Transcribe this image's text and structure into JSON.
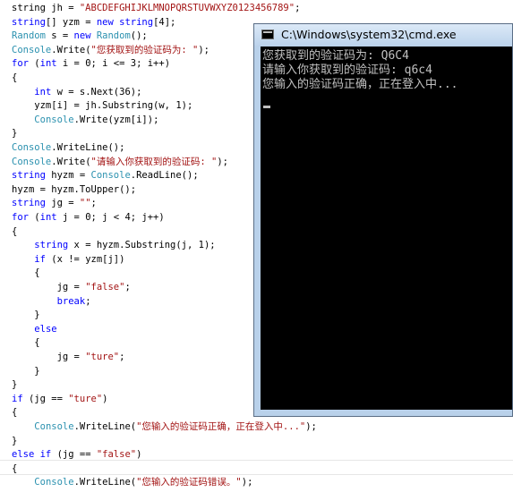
{
  "editor": {
    "lines": [
      [
        {
          "t": "pl",
          "v": "string jh = "
        },
        {
          "t": "str",
          "v": "\"ABCDEFGHIJKLMNOPQRSTUVWXYZ0123456789\""
        },
        {
          "t": "pl",
          "v": ";"
        }
      ],
      [
        {
          "t": "kw",
          "v": "string"
        },
        {
          "t": "pl",
          "v": "[] yzm = "
        },
        {
          "t": "kw",
          "v": "new string"
        },
        {
          "t": "pl",
          "v": "[4];"
        }
      ],
      [
        {
          "t": "cls",
          "v": "Random"
        },
        {
          "t": "pl",
          "v": " s = "
        },
        {
          "t": "kw",
          "v": "new "
        },
        {
          "t": "cls",
          "v": "Random"
        },
        {
          "t": "pl",
          "v": "();"
        }
      ],
      [
        {
          "t": "cls",
          "v": "Console"
        },
        {
          "t": "pl",
          "v": ".Write("
        },
        {
          "t": "str",
          "v": "\"您获取到的验证码为: \""
        },
        {
          "t": "pl",
          "v": ");"
        }
      ],
      [
        {
          "t": "kw",
          "v": "for"
        },
        {
          "t": "pl",
          "v": " ("
        },
        {
          "t": "kw",
          "v": "int"
        },
        {
          "t": "pl",
          "v": " i = 0; i <= 3; i++)"
        }
      ],
      [
        {
          "t": "pl",
          "v": "{"
        }
      ],
      [
        {
          "t": "pl",
          "v": "    "
        },
        {
          "t": "kw",
          "v": "int"
        },
        {
          "t": "pl",
          "v": " w = s.Next(36);"
        }
      ],
      [
        {
          "t": "pl",
          "v": "    yzm[i] = jh.Substring(w, 1);"
        }
      ],
      [
        {
          "t": "pl",
          "v": "    "
        },
        {
          "t": "cls",
          "v": "Console"
        },
        {
          "t": "pl",
          "v": ".Write(yzm[i]);"
        }
      ],
      [
        {
          "t": "pl",
          "v": "}"
        }
      ],
      [
        {
          "t": "cls",
          "v": "Console"
        },
        {
          "t": "pl",
          "v": ".WriteLine();"
        }
      ],
      [
        {
          "t": "cls",
          "v": "Console"
        },
        {
          "t": "pl",
          "v": ".Write("
        },
        {
          "t": "str",
          "v": "\"请输入你获取到的验证码: \""
        },
        {
          "t": "pl",
          "v": ");"
        }
      ],
      [
        {
          "t": "kw",
          "v": "string"
        },
        {
          "t": "pl",
          "v": " hyzm = "
        },
        {
          "t": "cls",
          "v": "Console"
        },
        {
          "t": "pl",
          "v": ".ReadLine();"
        }
      ],
      [
        {
          "t": "pl",
          "v": "hyzm = hyzm.ToUpper();"
        }
      ],
      [
        {
          "t": "kw",
          "v": "string"
        },
        {
          "t": "pl",
          "v": " jg = "
        },
        {
          "t": "str",
          "v": "\"\""
        },
        {
          "t": "pl",
          "v": ";"
        }
      ],
      [
        {
          "t": "kw",
          "v": "for"
        },
        {
          "t": "pl",
          "v": " ("
        },
        {
          "t": "kw",
          "v": "int"
        },
        {
          "t": "pl",
          "v": " j = 0; j < 4; j++)"
        }
      ],
      [
        {
          "t": "pl",
          "v": "{"
        }
      ],
      [
        {
          "t": "pl",
          "v": "    "
        },
        {
          "t": "kw",
          "v": "string"
        },
        {
          "t": "pl",
          "v": " x = hyzm.Substring(j, 1);"
        }
      ],
      [
        {
          "t": "pl",
          "v": "    "
        },
        {
          "t": "kw",
          "v": "if"
        },
        {
          "t": "pl",
          "v": " (x != yzm[j])"
        }
      ],
      [
        {
          "t": "pl",
          "v": "    {"
        }
      ],
      [
        {
          "t": "pl",
          "v": "        jg = "
        },
        {
          "t": "str",
          "v": "\"false\""
        },
        {
          "t": "pl",
          "v": ";"
        }
      ],
      [
        {
          "t": "pl",
          "v": "        "
        },
        {
          "t": "kw",
          "v": "break"
        },
        {
          "t": "pl",
          "v": ";"
        }
      ],
      [
        {
          "t": "pl",
          "v": "    }"
        }
      ],
      [
        {
          "t": "pl",
          "v": "    "
        },
        {
          "t": "kw",
          "v": "else"
        }
      ],
      [
        {
          "t": "pl",
          "v": "    {"
        }
      ],
      [
        {
          "t": "pl",
          "v": "        jg = "
        },
        {
          "t": "str",
          "v": "\"ture\""
        },
        {
          "t": "pl",
          "v": ";"
        }
      ],
      [
        {
          "t": "pl",
          "v": "    }"
        }
      ],
      [
        {
          "t": "pl",
          "v": "}"
        }
      ],
      [
        {
          "t": "kw",
          "v": "if"
        },
        {
          "t": "pl",
          "v": " (jg == "
        },
        {
          "t": "str",
          "v": "\"ture\""
        },
        {
          "t": "pl",
          "v": ")"
        }
      ],
      [
        {
          "t": "pl",
          "v": "{"
        }
      ],
      [
        {
          "t": "pl",
          "v": "    "
        },
        {
          "t": "cls",
          "v": "Console"
        },
        {
          "t": "pl",
          "v": ".WriteLine("
        },
        {
          "t": "str",
          "v": "\"您输入的验证码正确，正在登入中...\""
        },
        {
          "t": "pl",
          "v": ");"
        }
      ],
      [
        {
          "t": "pl",
          "v": "}"
        }
      ],
      [
        {
          "t": "kw",
          "v": "else if"
        },
        {
          "t": "pl",
          "v": " (jg == "
        },
        {
          "t": "str",
          "v": "\"false\""
        },
        {
          "t": "pl",
          "v": ")"
        }
      ],
      [
        {
          "t": "pl",
          "v": "{"
        }
      ],
      [
        {
          "t": "pl",
          "v": "    "
        },
        {
          "t": "cls",
          "v": "Console"
        },
        {
          "t": "pl",
          "v": ".WriteLine("
        },
        {
          "t": "str",
          "v": "\"您输入的验证码错误。\""
        },
        {
          "t": "pl",
          "v": ");"
        }
      ]
    ]
  },
  "console_window": {
    "title": "C:\\Windows\\system32\\cmd.exe",
    "icon": "console-icon",
    "output": [
      "您获取到的验证码为: Q6C4",
      "请输入你获取到的验证码: q6c4",
      "您输入的验证码正确，正在登入中..."
    ]
  },
  "colors": {
    "keyword": "#0000ff",
    "string": "#a31515",
    "type": "#2b91af",
    "console_bg": "#000000",
    "console_text": "#c0c0c0"
  }
}
